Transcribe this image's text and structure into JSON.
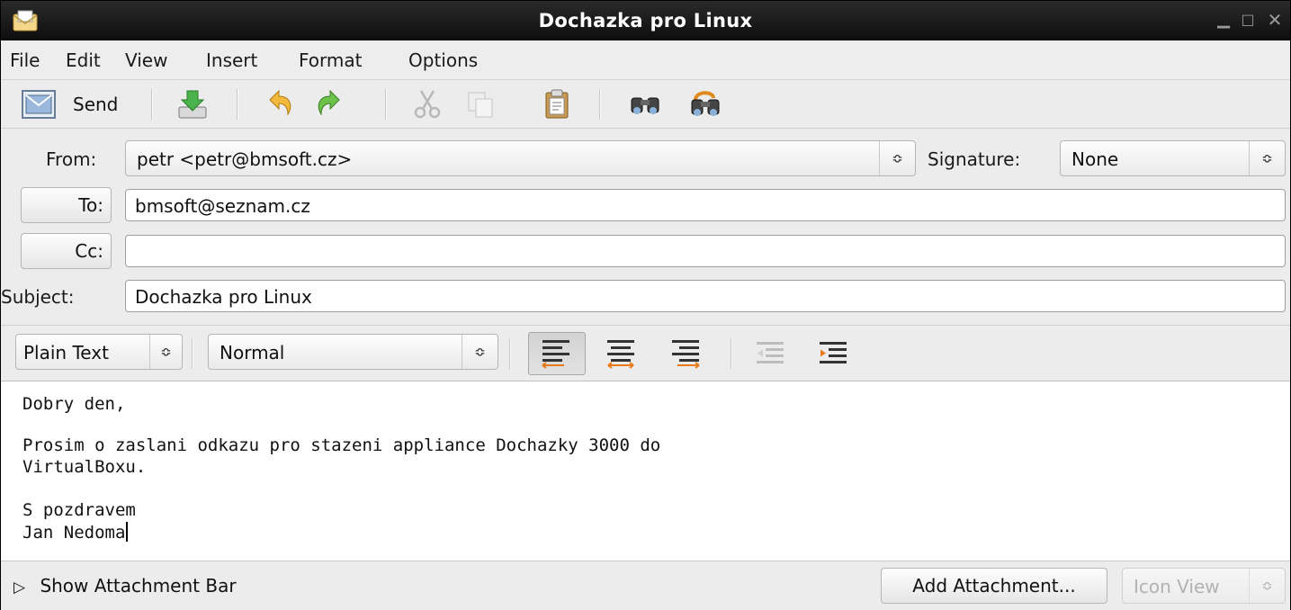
{
  "window": {
    "title": "Dochazka pro Linux"
  },
  "menu": [
    "File",
    "Edit",
    "View",
    "Insert",
    "Format",
    "Options"
  ],
  "toolbar": {
    "send_label": "Send"
  },
  "header": {
    "from_label": "From:",
    "from_value": "petr <petr@bmsoft.cz>",
    "signature_label": "Signature:",
    "signature_value": "None",
    "to_label": "To:",
    "to_value": "bmsoft@seznam.cz",
    "cc_label": "Cc:",
    "cc_value": "",
    "subject_label": "Subject:",
    "subject_value": "Dochazka pro Linux"
  },
  "format": {
    "mode": "Plain Text",
    "paragraph_style": "Normal",
    "active_alignment": "left"
  },
  "body": {
    "lines": [
      "Dobry den,",
      "",
      "Prosim o zaslani odkazu pro stazeni appliance Dochazky 3000 do",
      "VirtualBoxu.",
      "",
      "S pozdravem",
      "Jan Nedoma"
    ]
  },
  "footer": {
    "show_attachment_label": "Show Attachment Bar",
    "add_attachment_label": "Add Attachment...",
    "view_mode": "Icon View"
  },
  "colors": {
    "titlebar": "#111111",
    "chrome": "#ececec",
    "accent_orange": "#e87a18",
    "accent_green": "#3aa83a"
  }
}
